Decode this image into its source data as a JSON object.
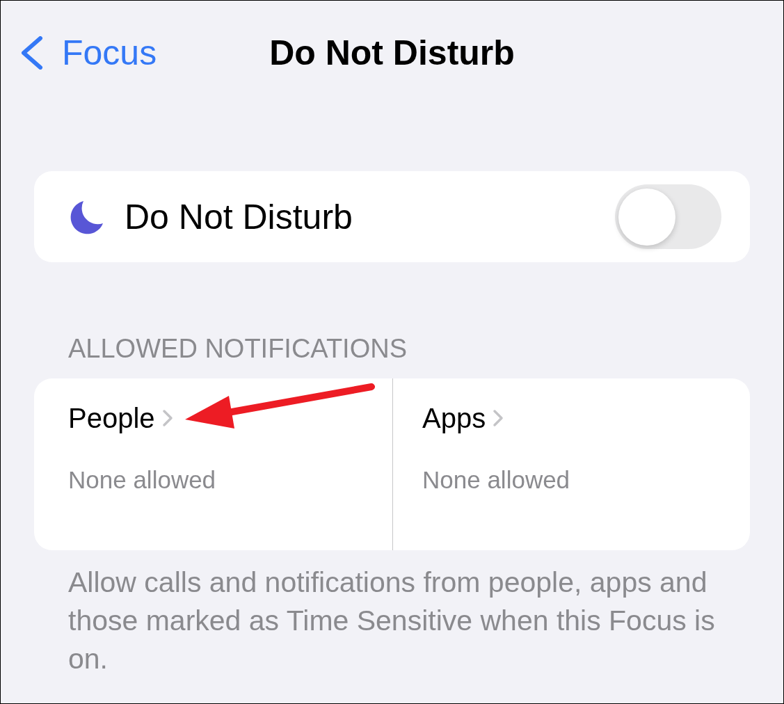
{
  "nav": {
    "back_label": "Focus",
    "title": "Do Not Disturb"
  },
  "focus_toggle": {
    "label": "Do Not Disturb",
    "on": false
  },
  "allowed_notifications": {
    "header": "ALLOWED NOTIFICATIONS",
    "tiles": [
      {
        "title": "People",
        "status": "None allowed"
      },
      {
        "title": "Apps",
        "status": "None allowed"
      }
    ]
  },
  "footer": "Allow calls and notifications from people, apps and those marked as Time Sensitive when this Focus is on."
}
